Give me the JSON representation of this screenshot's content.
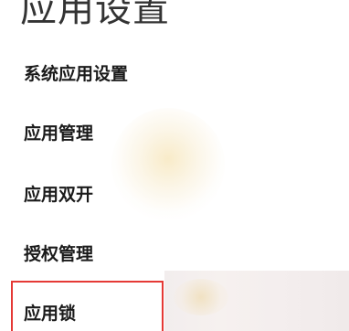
{
  "page": {
    "title": "应用设置"
  },
  "menu": {
    "items": [
      {
        "label": "系统应用设置"
      },
      {
        "label": "应用管理"
      },
      {
        "label": "应用双开"
      },
      {
        "label": "授权管理"
      },
      {
        "label": "应用锁",
        "highlighted": true
      }
    ]
  },
  "colors": {
    "highlight_border": "#e53935",
    "text": "#1a1a1a",
    "title_text": "#333333"
  }
}
